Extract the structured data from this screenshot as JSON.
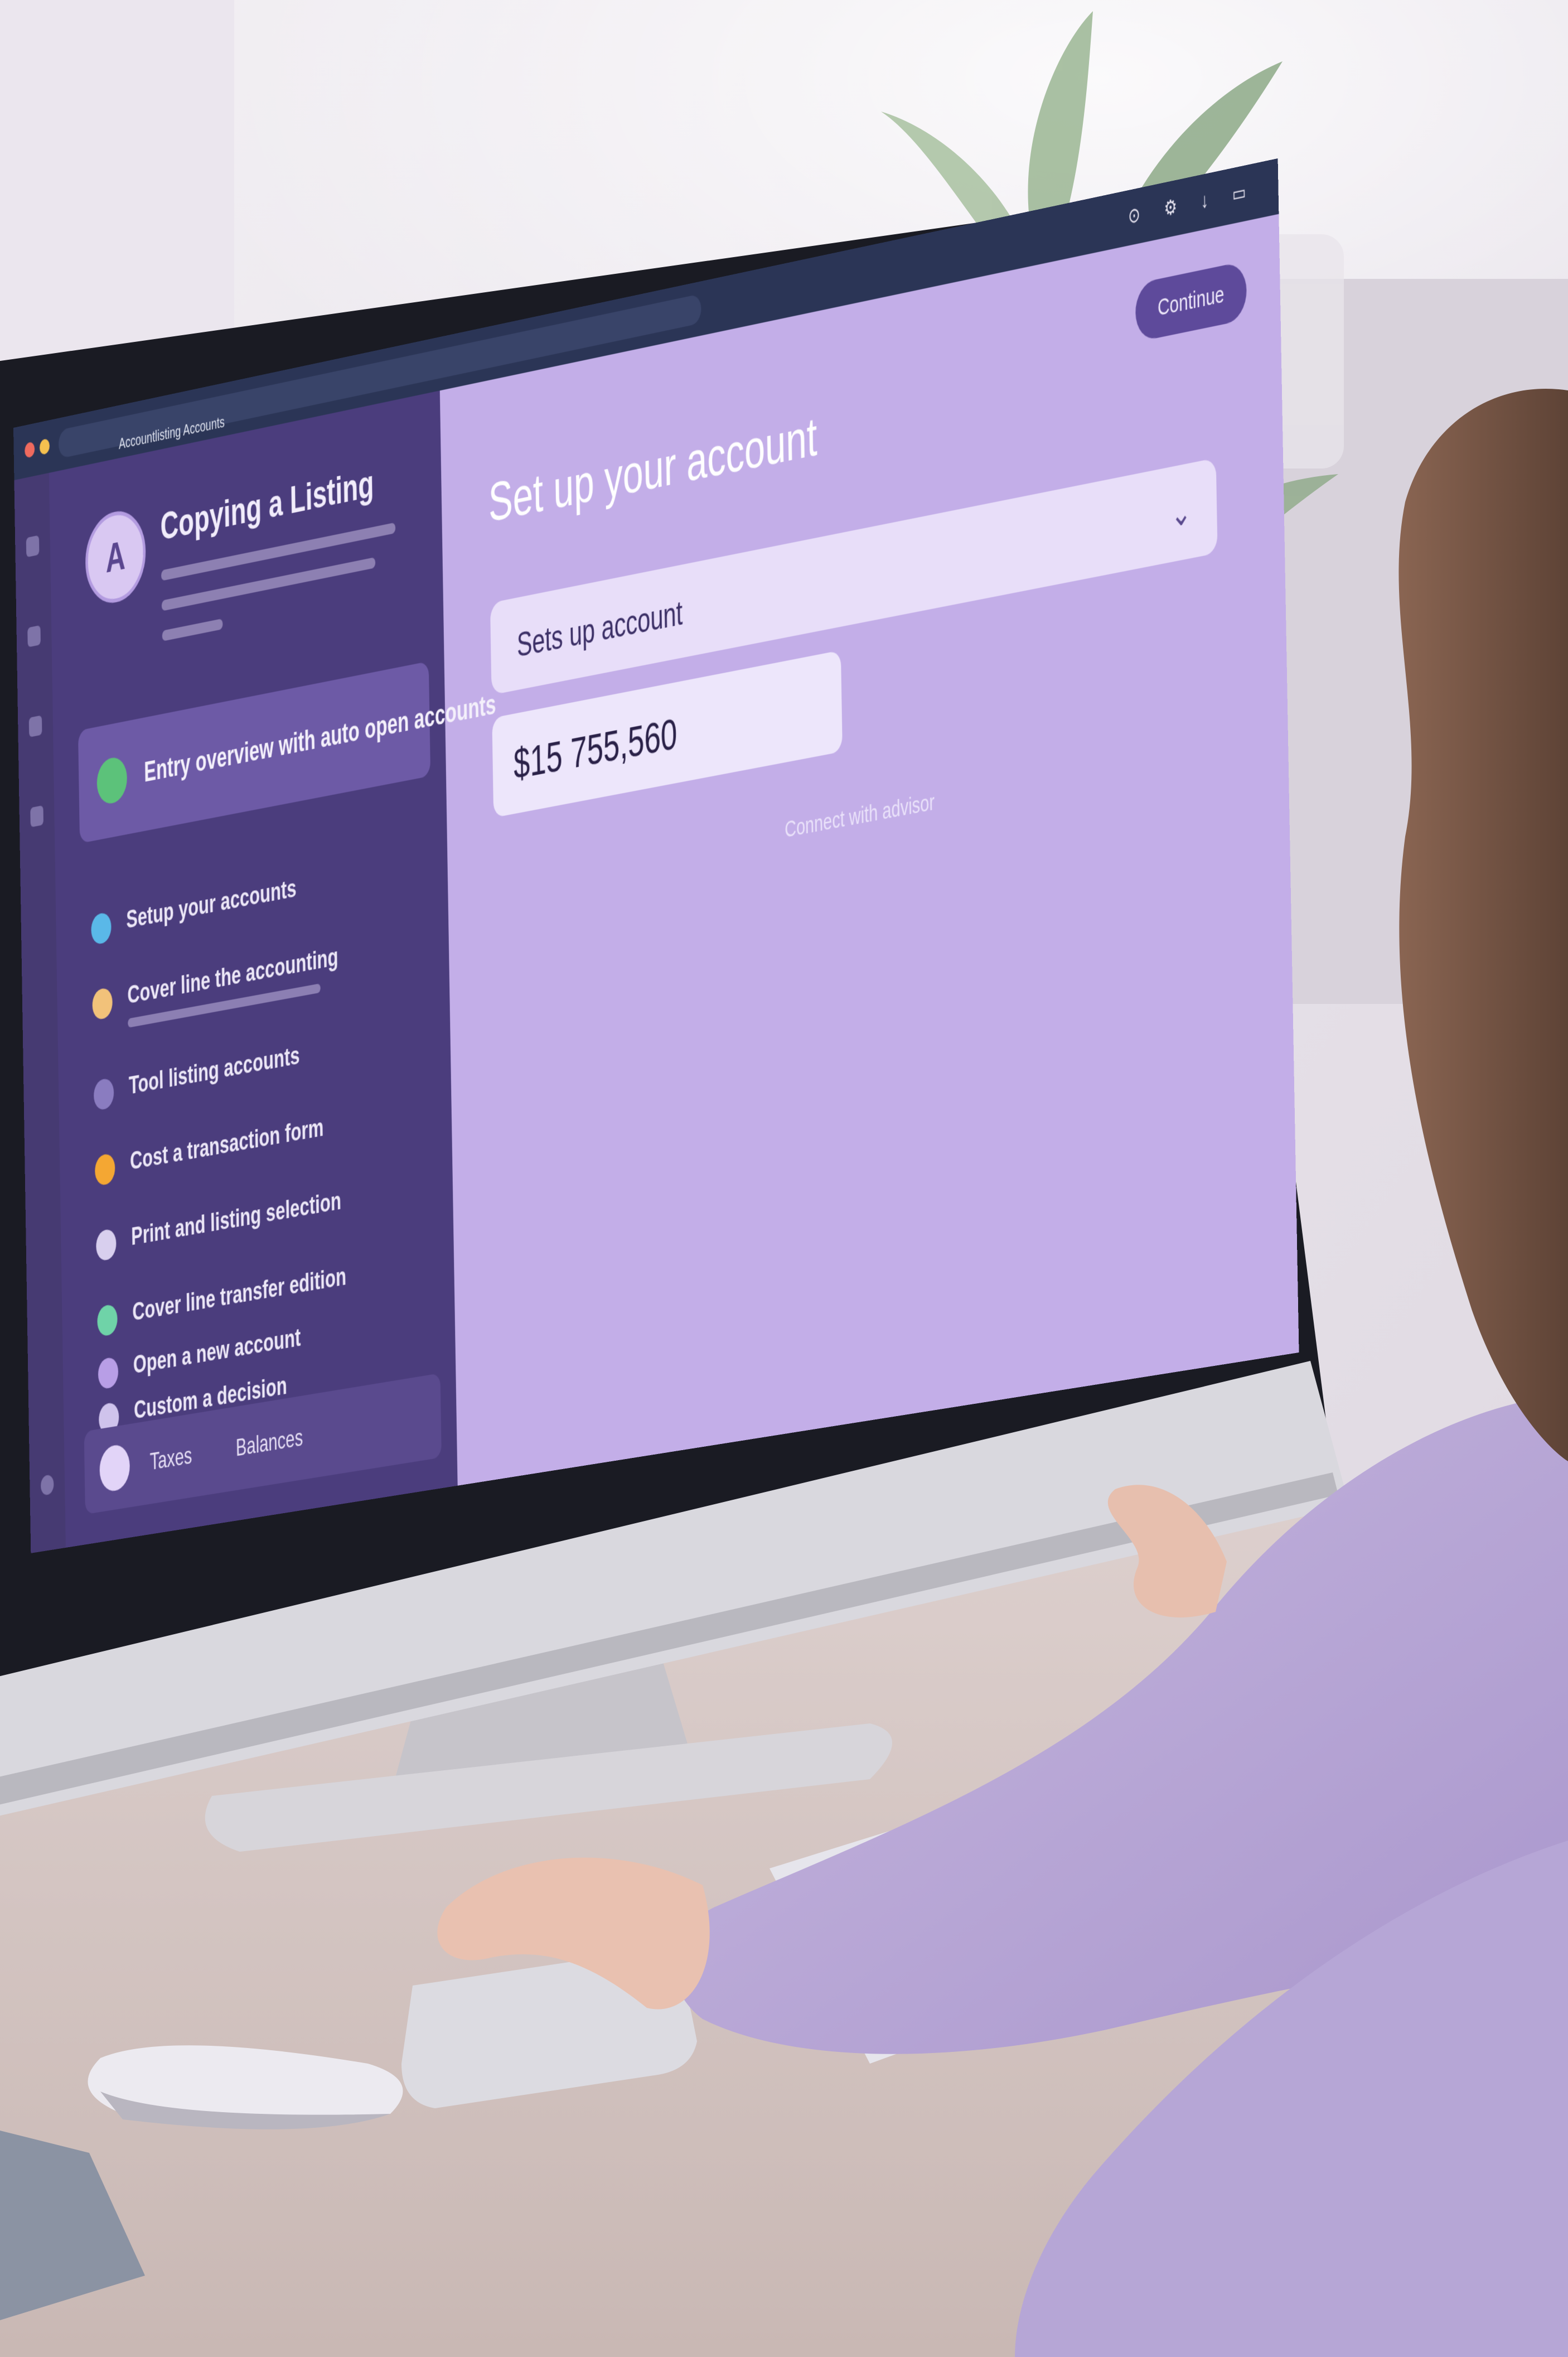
{
  "browser": {
    "breadcrumb": "Accountlisting  Accounts",
    "top_icons": "⊙ ⚙ ↓ ▭"
  },
  "sidebar": {
    "profile_title": "Copying a Listing",
    "profile_initial": "A",
    "highlight_label": "Entry overview with auto open accounts",
    "items": [
      {
        "label": "Setup your accounts",
        "dot_color": "#5ab8e8"
      },
      {
        "label": "Cover line the accounting",
        "dot_color": "#f2c27a"
      },
      {
        "label": "Tool listing accounts",
        "dot_color": "#8a7cc0"
      },
      {
        "label": "Cost a transaction form",
        "dot_color": "#f4a733"
      },
      {
        "label": "Print and listing selection",
        "dot_color": "#d8cfee"
      },
      {
        "label": "Cover line transfer edition",
        "dot_color": "#6fd3a8"
      },
      {
        "label": "Open a new account",
        "dot_color": "#b89ee6"
      },
      {
        "label": "Custom a decision",
        "dot_color": "#cfc3ec"
      }
    ],
    "footer_left": "Taxes",
    "footer_right": "Balances"
  },
  "main": {
    "continue_label": "Continue",
    "title": "Set up your account",
    "select_value": "Sets up account",
    "amount_value": "$15 755,560",
    "helper_link": "Connect with advisor"
  },
  "colors": {
    "screen_bg": "#c3aee8",
    "sidebar_bg": "#4b3d7d",
    "accent": "#5e4a9b"
  }
}
